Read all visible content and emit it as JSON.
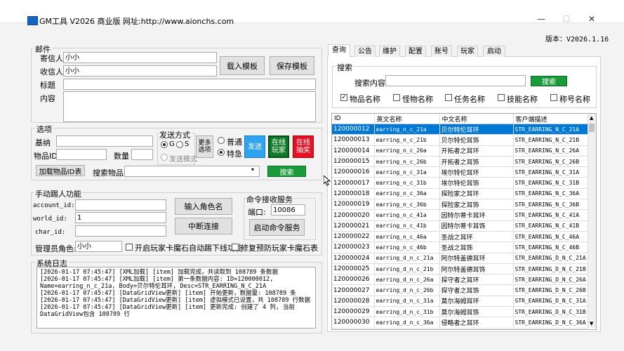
{
  "window": {
    "title": "GM工具 V2026 商业版 网址:http://www.aionchs.com",
    "minimize": "—",
    "maximize": "☐",
    "close": "✕"
  },
  "version": "版本：V2026.1.16",
  "mail": {
    "group_label": "邮件",
    "sender_label": "寄信人",
    "sender_value": "小小",
    "receiver_label": "收信人",
    "receiver_value": "小小",
    "title_label": "标题",
    "title_value": "",
    "content_label": "内容",
    "content_value": "",
    "load_template": "载入模板",
    "save_template": "保存模板"
  },
  "options": {
    "group_label": "选项",
    "kinah_label": "基纳",
    "kinah_value": "",
    "item_id_label": "物品ID",
    "item_id_value": "",
    "quantity_label": "数量",
    "quantity_value": "",
    "send_mode_label": "发送方式",
    "mode_g": "G",
    "mode_s": "S",
    "mode_g_selected": true,
    "mode_send": "发送模式",
    "more_options": "更多选项",
    "normal": "普通",
    "express": "特急",
    "express_selected": true,
    "send_tile": "发送",
    "online_player_tile": "在线玩家",
    "online_draw_tile": "在线抽奖",
    "load_items_btn": "加载物品ID表",
    "search_items_label": "搜索物品",
    "search_items_value": "",
    "search_btn": "搜索"
  },
  "kick": {
    "group_label": "手动踢人功能",
    "account_label": "account_id:",
    "account_value": "",
    "world_label": "world_id:",
    "world_value": "1",
    "char_label": "char_id:",
    "char_value": "",
    "input_role_btn": "输入角色名",
    "interrupt_btn": "中断连接",
    "admin_label": "管理员角色:",
    "admin_value": "小小",
    "auto_kick_label": "开启玩家卡魔石自动踢下线功能",
    "fix_stone_label": "修复预防玩家卡魔石表"
  },
  "command": {
    "group_label": "命令接收服务",
    "port_label": "端口:",
    "port_value": "10086",
    "start_btn": "启动命令服务"
  },
  "log": {
    "group_label": "系统日志",
    "lines": [
      "[2026-01-17 07:45:47] [XML加载] [item] 加载完成，共读取到 108789 条数据",
      "[2026-01-17 07:45:47] [XML加载] [item] 第一条数据内容: ID=120000012,",
      "Name=earring_n_c_21a, Body=贝尔特伦耳环, Desc=STR_EARRING_N_C_21A",
      "[2026-01-17 07:45:47] [DataGridView更新] [item] 开始更新，数据量: 108789 条",
      "[2026-01-17 07:45:47] [DataGridView更新] [item] 虚拟模式已设置，共 108789 行数据",
      "[2026-01-17 07:45:47] [DataGridView更新] [item] 更新完成: 创建了 4 列, 当前",
      "DataGridView包含 108789 行"
    ]
  },
  "tabs": [
    "查询",
    "公告",
    "维护",
    "配置",
    "账号",
    "玩家",
    "启动"
  ],
  "query": {
    "group_label": "搜索",
    "content_label": "搜索内容",
    "content_value": "",
    "search_btn": "搜索",
    "checks": [
      {
        "label": "物品名称",
        "checked": true
      },
      {
        "label": "怪物名称",
        "checked": false
      },
      {
        "label": "任务名称",
        "checked": false
      },
      {
        "label": "技能名称",
        "checked": false
      },
      {
        "label": "称号名称",
        "checked": false
      }
    ]
  },
  "table": {
    "headers": [
      "ID",
      "英文名称",
      "中文名称",
      "客户端描述"
    ],
    "rows": [
      [
        "120000012",
        "earring_n_c_21a",
        "贝尔特伦耳环",
        "STR_EARRING_N_C_21A"
      ],
      [
        "120000013",
        "earring_n_c_21b",
        "贝尔特伦耳饰",
        "STR_EARRING_N_C_21B"
      ],
      [
        "120000014",
        "earring_n_c_26a",
        "开拓者之耳环",
        "STR_EARRING_N_C_26A"
      ],
      [
        "120000015",
        "earring_n_c_26b",
        "开拓者之耳饰",
        "STR_EARRING_N_C_26B"
      ],
      [
        "120000016",
        "earring_n_c_31a",
        "埃尔特伦耳环",
        "STR_EARRING_N_C_31A"
      ],
      [
        "120000017",
        "earring_n_c_31b",
        "埃尔特伦耳饰",
        "STR_EARRING_N_C_31B"
      ],
      [
        "120000018",
        "earring_n_c_36a",
        "探险家之耳环",
        "STR_EARRING_N_C_36A"
      ],
      [
        "120000019",
        "earring_n_c_36b",
        "探险家之耳饰",
        "STR_EARRING_N_C_36B"
      ],
      [
        "120000020",
        "earring_n_c_41a",
        "因特尔蒂卡耳环",
        "STR_EARRING_N_C_41A"
      ],
      [
        "120000021",
        "earring_n_c_41b",
        "因特尔蒂卡耳饰",
        "STR_EARRING_N_C_41B"
      ],
      [
        "120000022",
        "earring_n_c_46a",
        "圣战之耳环",
        "STR_EARRING_N_C_46A"
      ],
      [
        "120000023",
        "earring_n_c_46b",
        "圣战之耳饰",
        "STR_EARRING_N_C_46B"
      ],
      [
        "120000024",
        "earring_d_n_c_21a",
        "阿尔特盖德耳环",
        "STR_EARRING_D_N_C_21A"
      ],
      [
        "120000025",
        "earring_d_n_c_21b",
        "阿尔特盖德耳饰",
        "STR_EARRING_D_N_C_21B"
      ],
      [
        "120000026",
        "earring_d_n_c_26a",
        "探守者之耳环",
        "STR_EARRING_D_N_C_26A"
      ],
      [
        "120000027",
        "earring_d_n_c_26b",
        "探守者之耳饰",
        "STR_EARRING_D_N_C_26B"
      ],
      [
        "120000028",
        "earring_d_n_c_31a",
        "莫尔海姆耳环",
        "STR_EARRING_D_N_C_31A"
      ],
      [
        "120000029",
        "earring_d_n_c_31b",
        "莫尔海姆耳饰",
        "STR_EARRING_D_N_C_31B"
      ],
      [
        "120000030",
        "earring_d_n_c_36a",
        "侵略者之耳环",
        "STR_EARRING_D_N_C_36A"
      ]
    ]
  }
}
